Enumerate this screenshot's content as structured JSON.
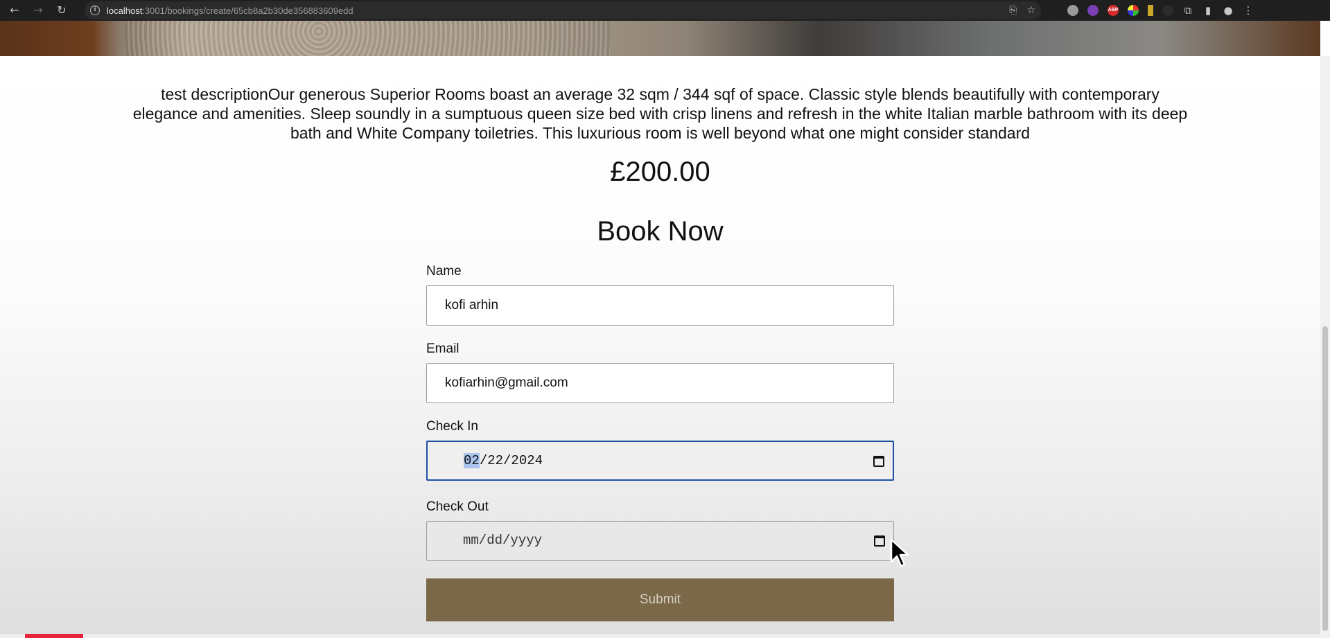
{
  "browser": {
    "url_host": "localhost",
    "url_path": ":3001/bookings/create/65cb8a2b30de356883609edd",
    "back_icon": "arrow-left-icon",
    "forward_icon": "arrow-right-icon",
    "reload_icon": "reload-icon",
    "extension_abp": "ABP"
  },
  "room": {
    "description": "test descriptionOur generous Superior Rooms boast an average 32 sqm / 344 sqf of space. Classic style blends beautifully with contemporary elegance and amenities. Sleep soundly in a sumptuous queen size bed with crisp linens and refresh in the white Italian marble bathroom with its deep bath and White Company toiletries. This luxurious room is well beyond what one might consider standard",
    "price": "£200.00"
  },
  "form": {
    "heading": "Book Now",
    "name_label": "Name",
    "name_value": "kofi arhin",
    "email_label": "Email",
    "email_value": "kofiarhin@gmail.com",
    "checkin_label": "Check In",
    "checkin_month": "02",
    "checkin_rest": "/22/2024",
    "checkout_label": "Check Out",
    "checkout_placeholder": "mm/dd/yyyy",
    "submit_label": "Submit"
  },
  "colors": {
    "submit_bg": "#7a6848",
    "focus_border": "#1e4fa3",
    "progress": "#e8223b"
  },
  "video_progress": 0.063
}
